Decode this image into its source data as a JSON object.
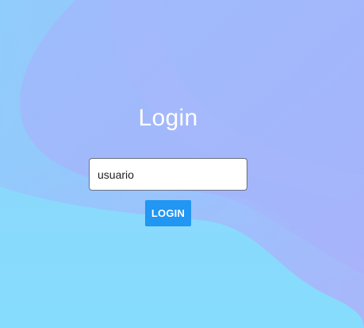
{
  "login": {
    "title": "Login",
    "username_value": "usuario",
    "submit_label": "LOGIN"
  },
  "colors": {
    "button_bg": "#2196f3",
    "title_text": "#ffffff",
    "background_light_blue": "#8fd6fb",
    "background_lavender": "#a3b4fa"
  }
}
